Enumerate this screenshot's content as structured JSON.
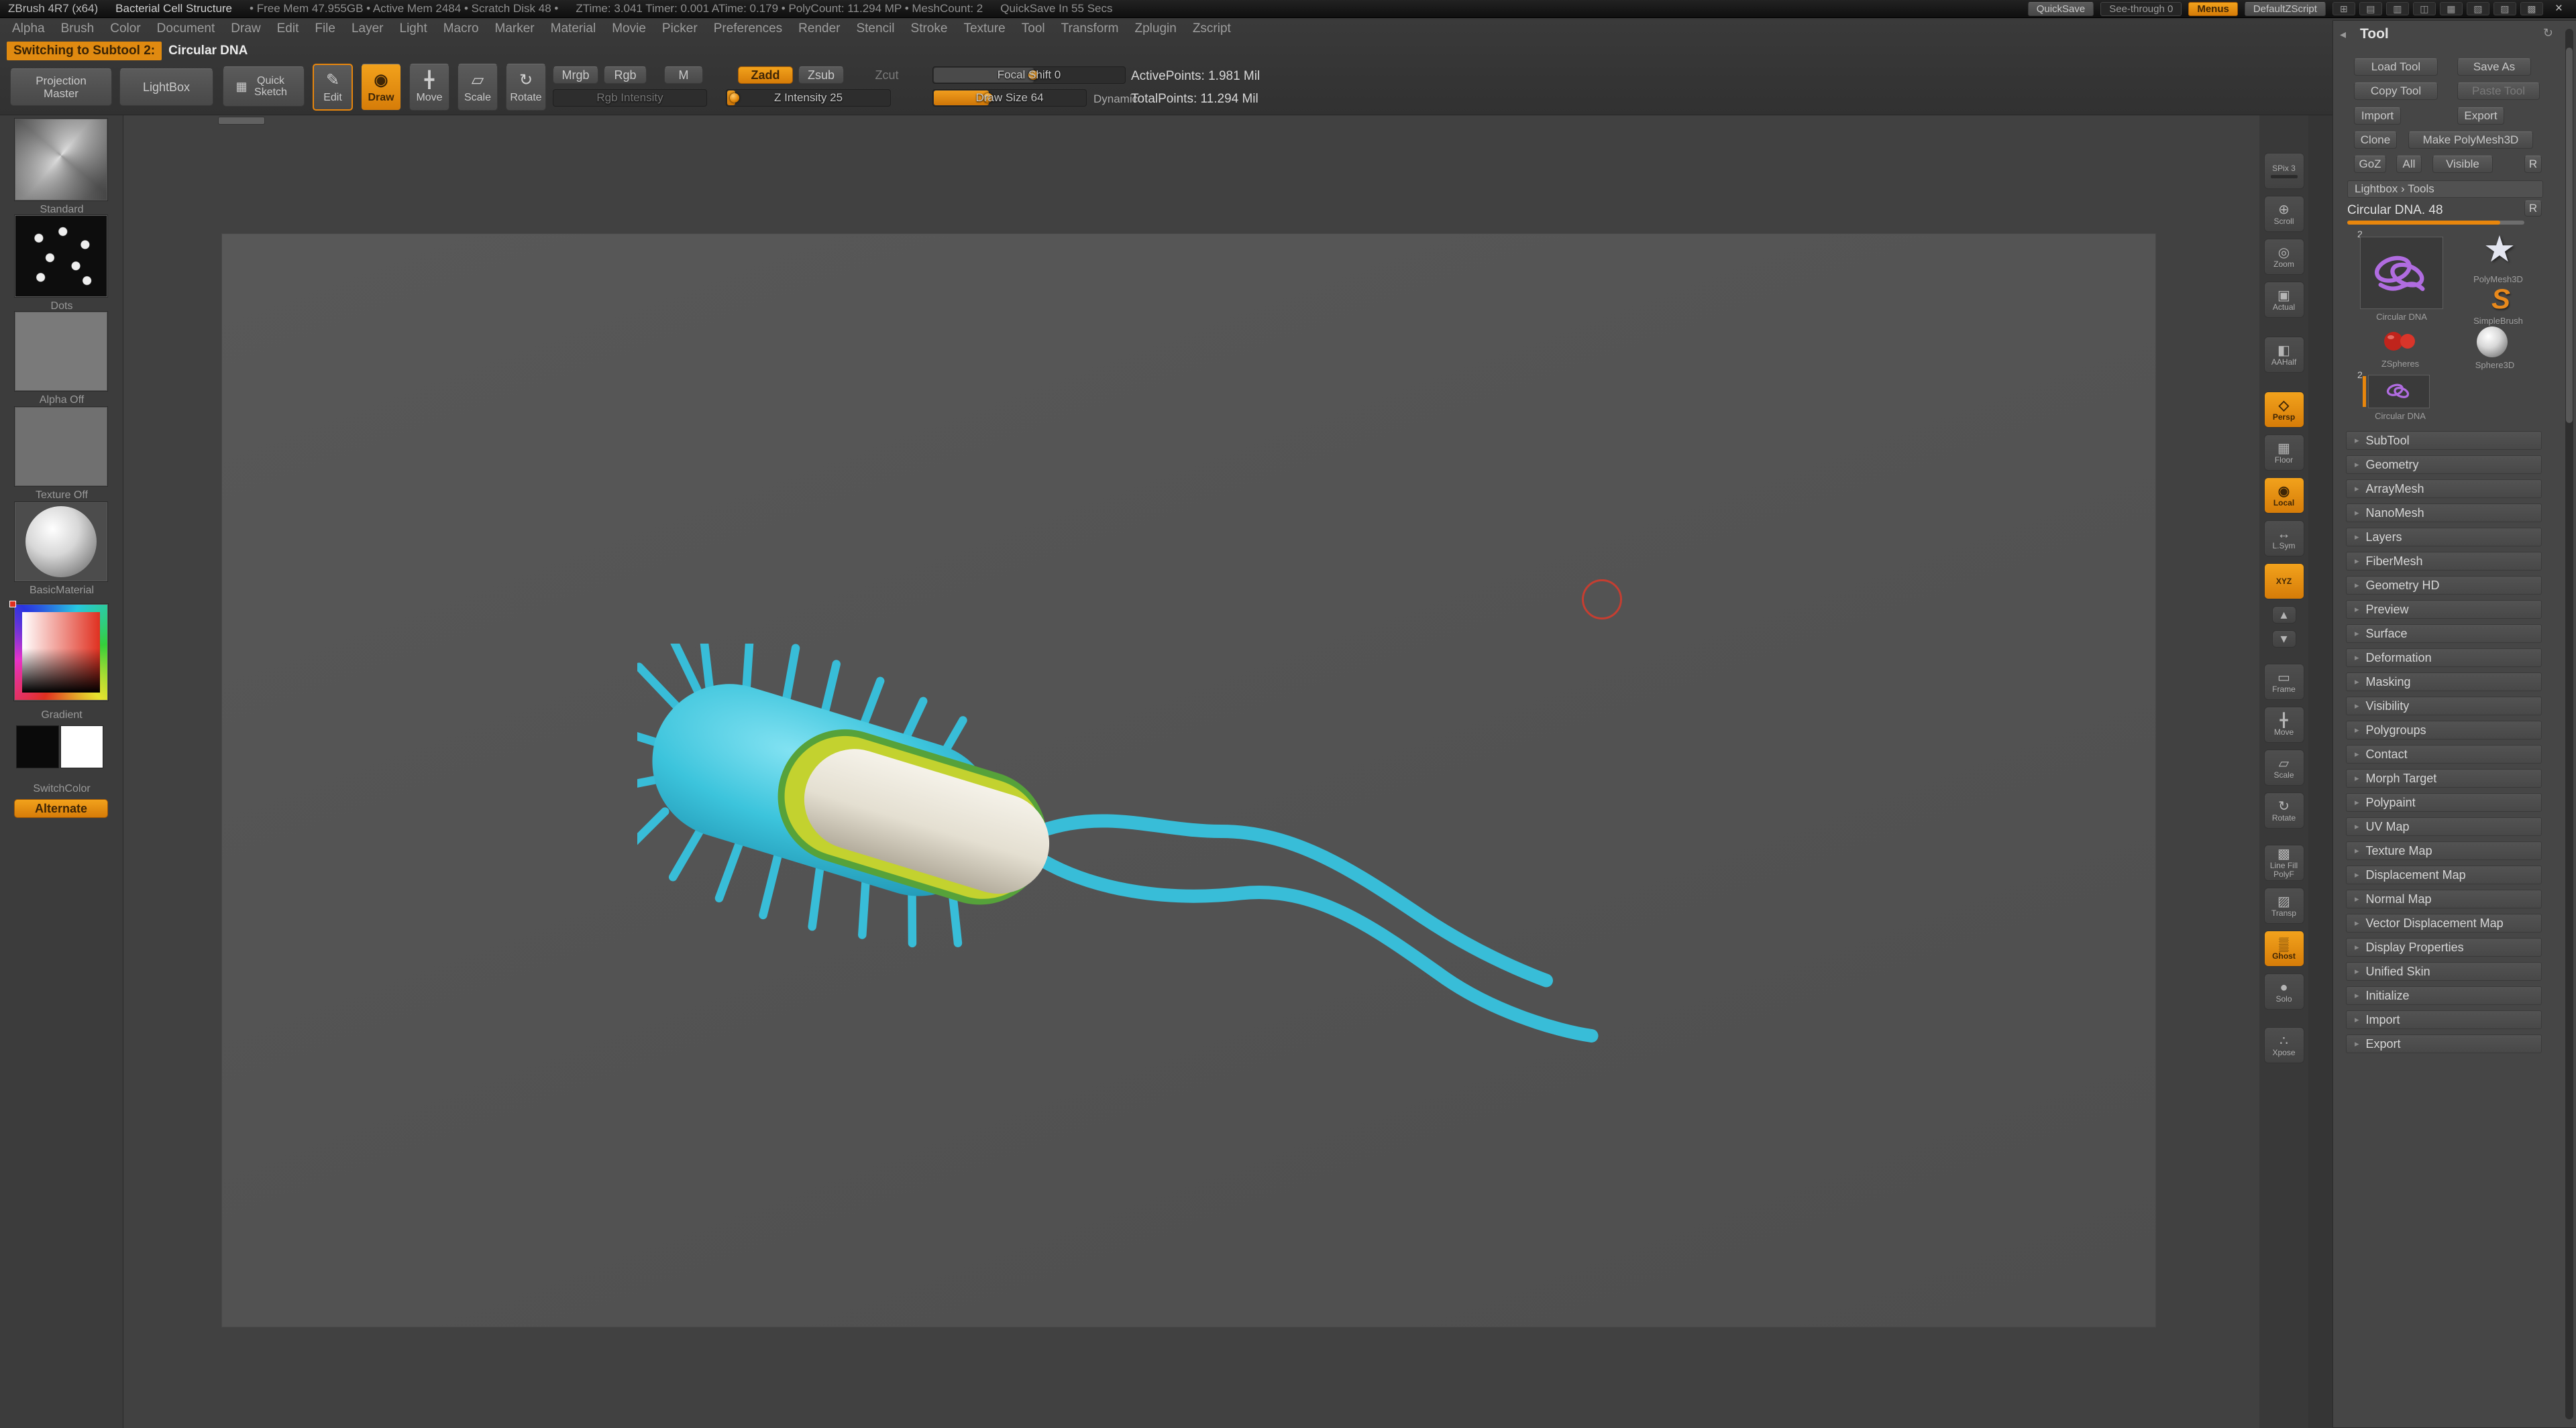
{
  "accent": "#e8860c",
  "title_bar": {
    "app": "ZBrush 4R7 (x64)",
    "document": "Bacterial Cell Structure",
    "memory": "• Free Mem 47.955GB • Active Mem 2484 • Scratch Disk 48 •",
    "timers": "ZTime: 3.041  Timer: 0.001  ATime: 0.179 • PolyCount: 11.294 MP • MeshCount: 2",
    "quicksave_note": "QuickSave In 55 Secs",
    "quicksave": "QuickSave",
    "see_through": "See-through 0",
    "menus": "Menus",
    "default_zscript": "DefaultZScript",
    "window_icons": [
      "⊞",
      "▤",
      "▥",
      "◫",
      "▦",
      "▧",
      "▨",
      "▩"
    ],
    "close": "×"
  },
  "menu_bar": [
    "Alpha",
    "Brush",
    "Color",
    "Document",
    "Draw",
    "Edit",
    "File",
    "Layer",
    "Light",
    "Macro",
    "Marker",
    "Material",
    "Movie",
    "Picker",
    "Preferences",
    "Render",
    "Stencil",
    "Stroke",
    "Texture",
    "Tool",
    "Transform",
    "Zplugin",
    "Zscript"
  ],
  "status": {
    "action": "Switching to Subtool 2:",
    "subject": "Circular DNA"
  },
  "shelf": {
    "projection_master": "Projection Master",
    "lightbox": "LightBox",
    "quick_sketch": "Quick Sketch",
    "modes": [
      {
        "label": "Edit",
        "glyph": "✎",
        "state": "outlined"
      },
      {
        "label": "Draw",
        "glyph": "◉",
        "active": true
      },
      {
        "label": "Move",
        "glyph": "╋"
      },
      {
        "label": "Scale",
        "glyph": "▱"
      },
      {
        "label": "Rotate",
        "glyph": "↻"
      }
    ],
    "mrgb": "Mrgb",
    "rgb": "Rgb",
    "m": "M",
    "rgb_intensity": "Rgb Intensity",
    "zadd": "Zadd",
    "zsub": "Zsub",
    "zcut": "Zcut",
    "z_intensity": "Z Intensity 25",
    "focal_shift": "Focal Shift 0",
    "draw_size": "Draw Size 64",
    "dynamic": "Dynamic",
    "active_points": "ActivePoints: 1.981 Mil",
    "total_points": "TotalPoints: 11.294 Mil"
  },
  "left_panel": {
    "brush_label": "Standard",
    "stroke_label": "Dots",
    "alpha_label": "Alpha Off",
    "texture_label": "Texture Off",
    "material_label": "BasicMaterial",
    "gradient_label": "Gradient",
    "switch_label": "SwitchColor",
    "alternate": "Alternate"
  },
  "right_shelf": [
    {
      "label": "SPix 3",
      "glyph": "",
      "kind": "spix"
    },
    {
      "label": "Scroll",
      "glyph": "⊕"
    },
    {
      "label": "Zoom",
      "glyph": "◎"
    },
    {
      "label": "Actual",
      "glyph": "▣"
    },
    {
      "label": "AAHalf",
      "glyph": "◧",
      "gap": 18
    },
    {
      "label": "Persp",
      "glyph": "◇",
      "active": true,
      "gap": 18
    },
    {
      "label": "Floor",
      "glyph": "▦"
    },
    {
      "label": "Local",
      "glyph": "◉",
      "active": true
    },
    {
      "label": "L.Sym",
      "glyph": "↔"
    },
    {
      "label": "XYZ",
      "glyph": "",
      "active": true
    },
    {
      "label": "",
      "glyph": "▴",
      "kind": "mini"
    },
    {
      "label": "",
      "glyph": "▾",
      "kind": "mini"
    },
    {
      "label": "Frame",
      "glyph": "▭",
      "gap": 14
    },
    {
      "label": "Move",
      "glyph": "╋"
    },
    {
      "label": "Scale",
      "glyph": "▱"
    },
    {
      "label": "Rotate",
      "glyph": "↻"
    },
    {
      "label": "Line Fill PolyF",
      "glyph": "▩",
      "gap": 14
    },
    {
      "label": "Transp",
      "glyph": "▨"
    },
    {
      "label": "Ghost",
      "glyph": "▒",
      "active": true
    },
    {
      "label": "Solo",
      "glyph": "●"
    },
    {
      "label": "Xpose",
      "glyph": "∴",
      "gap": 16
    }
  ],
  "tool_panel": {
    "title": "Tool",
    "load": "Load Tool",
    "save_as": "Save As",
    "copy": "Copy Tool",
    "paste": "Paste Tool",
    "import": "Import",
    "export": "Export",
    "clone": "Clone",
    "make_polymesh": "Make PolyMesh3D",
    "goz": "GoZ",
    "all": "All",
    "visible": "Visible",
    "r": "R",
    "lightbox_tools": "Lightbox › Tools",
    "current_tool": "Circular DNA. 48",
    "slot_badge": "2",
    "thumbs": {
      "dna": "Circular DNA",
      "star": "PolyMesh3D",
      "simple": "SimpleBrush",
      "zspheres": "ZSpheres",
      "sphere": "Sphere3D"
    },
    "thumb_glyphs": {
      "star": "★",
      "simple": "S"
    },
    "quick_pick": {
      "badge": "2",
      "label": "Circular DNA"
    },
    "sections": [
      "SubTool",
      "Geometry",
      "ArrayMesh",
      "NanoMesh",
      "Layers",
      "FiberMesh",
      "Geometry HD",
      "Preview",
      "Surface",
      "Deformation",
      "Masking",
      "Visibility",
      "Polygroups",
      "Contact",
      "Morph Target",
      "Polypaint",
      "UV Map",
      "Texture Map",
      "Displacement Map",
      "Normal Map",
      "Vector Displacement Map",
      "Display Properties",
      "Unified Skin",
      "Initialize",
      "Import",
      "Export"
    ]
  },
  "icons": {
    "collapse": "◂",
    "refresh": "↻",
    "section_bullet": "▸"
  }
}
